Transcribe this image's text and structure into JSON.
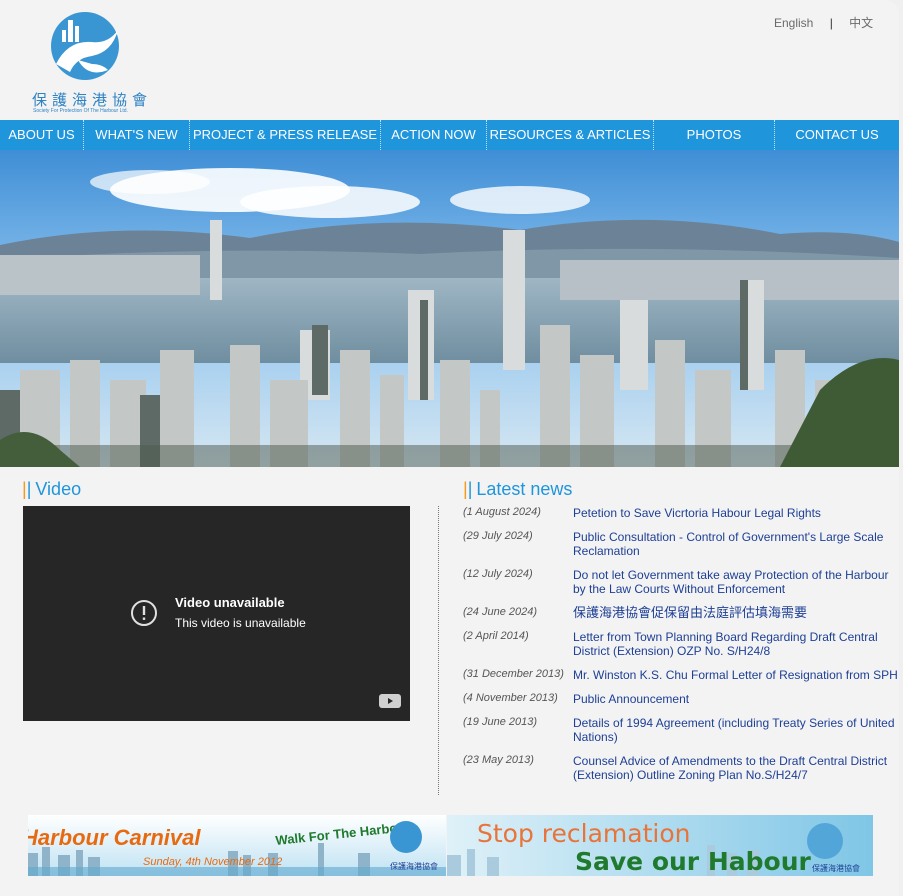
{
  "header": {
    "logo_cn": "保護海港協會",
    "logo_en": "Society For Protection Of The Harbour Ltd.",
    "lang_english": "English",
    "lang_sep": "|",
    "lang_chinese": "中文"
  },
  "nav": {
    "items": [
      {
        "label": "ABOUT US"
      },
      {
        "label": "WHAT'S NEW"
      },
      {
        "label": "PROJECT & PRESS RELEASE"
      },
      {
        "label": "ACTION NOW"
      },
      {
        "label": "RESOURCES & ARTICLES"
      },
      {
        "label": "PHOTOS"
      },
      {
        "label": "CONTACT US"
      }
    ]
  },
  "video": {
    "title_bar": "|",
    "title_bar2": "|",
    "title": "Video",
    "unavailable_title": "Video unavailable",
    "unavailable_sub": "This video is unavailable"
  },
  "news": {
    "title": "Latest news",
    "items": [
      {
        "date": "(1 August 2024)",
        "text": "Petetion to Save Vicrtoria Habour Legal Rights"
      },
      {
        "date": "(29 July 2024)",
        "text": "Public Consultation - Control of Government's Large Scale Reclamation"
      },
      {
        "date": "(12 July 2024)",
        "text": "Do not let Government take away Protection of the Harbour by the Law Courts Without Enforcement"
      },
      {
        "date": "(24 June 2024)",
        "text": "保護海港協會促保留由法庭評估填海需要"
      },
      {
        "date": "(2 April 2014)",
        "text": "Letter from Town Planning Board Regarding Draft Central District (Extension) OZP No. S/H24/8"
      },
      {
        "date": "(31 December 2013)",
        "text": "Mr. Winston K.S. Chu Formal Letter of Resignation from SPH"
      },
      {
        "date": "(4 November 2013)",
        "text": "Public Announcement"
      },
      {
        "date": "(19 June 2013)",
        "text": "Details of 1994 Agreement (including Treaty Series of United Nations)"
      },
      {
        "date": "(23 May 2013)",
        "text": "Counsel Advice of Amendments to the Draft Central District (Extension) Outline Zoning Plan No.S/H24/7"
      }
    ]
  },
  "banners": {
    "carnival_title": "Harbour Carnival",
    "carnival_date": "Sunday, 4th November 2012",
    "walk": "Walk For The Harbour",
    "carnival_logo_cn": "保護海港協會",
    "stop": "Stop reclamation",
    "save": "Save our Habour",
    "stop_logo_cn": "保護海港協會"
  },
  "colors": {
    "nav_bg": "#1f95dc",
    "title_blue": "#1f95dc",
    "accent_orange": "#f39a1f",
    "link_blue": "#1d3f95"
  }
}
